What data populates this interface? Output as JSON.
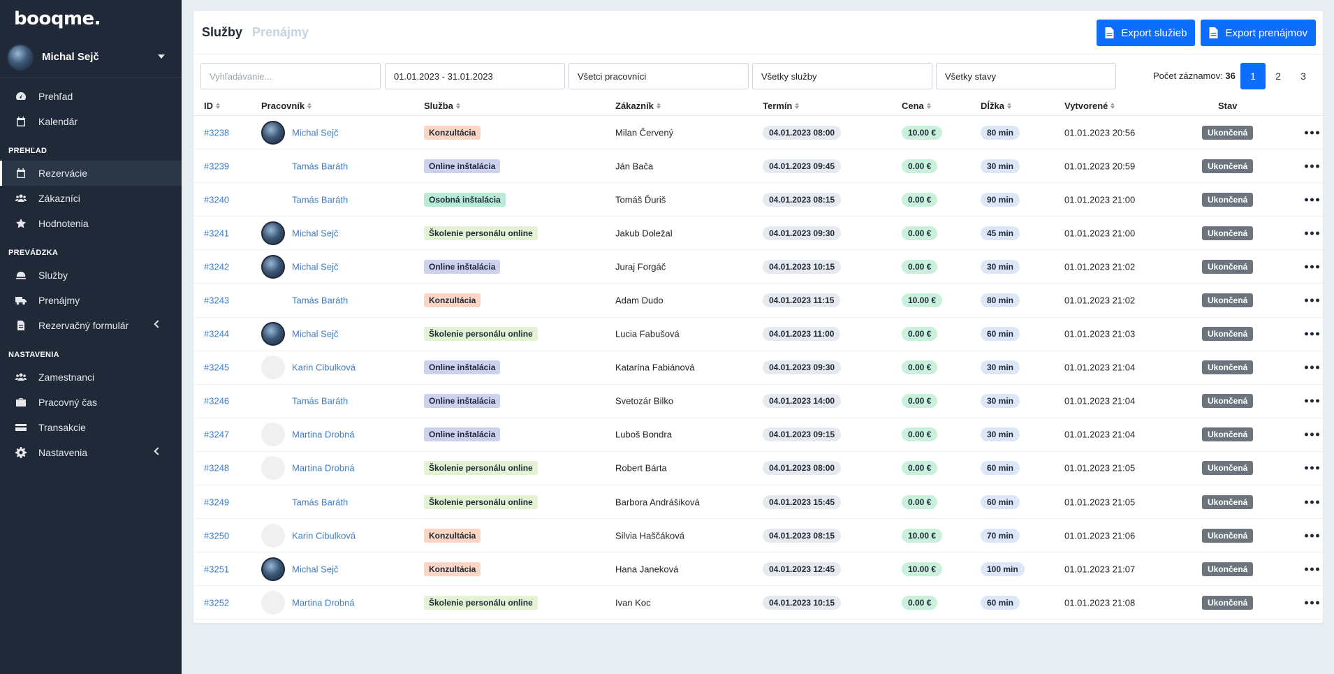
{
  "app": {
    "logo": "booqme."
  },
  "user": {
    "name": "Michal Sejč"
  },
  "sidebar": {
    "top_items": [
      {
        "label": "Prehľad",
        "icon": "gauge-icon"
      },
      {
        "label": "Kalendár",
        "icon": "calendar-icon"
      }
    ],
    "sections": [
      {
        "title": "PREHĽAD",
        "items": [
          {
            "label": "Rezervácie",
            "icon": "calendar-check-icon",
            "active": true
          },
          {
            "label": "Zákazníci",
            "icon": "users-icon"
          },
          {
            "label": "Hodnotenia",
            "icon": "star-icon"
          }
        ]
      },
      {
        "title": "PREVÁDZKA",
        "items": [
          {
            "label": "Služby",
            "icon": "service-icon"
          },
          {
            "label": "Prenájmy",
            "icon": "truck-icon"
          },
          {
            "label": "Rezervačný formulár",
            "icon": "form-icon",
            "chevron": true
          }
        ]
      },
      {
        "title": "NASTAVENIA",
        "items": [
          {
            "label": "Zamestnanci",
            "icon": "users-icon"
          },
          {
            "label": "Pracovný čas",
            "icon": "briefcase-icon"
          },
          {
            "label": "Transakcie",
            "icon": "credit-card-icon"
          },
          {
            "label": "Nastavenia",
            "icon": "gear-icon",
            "chevron": true
          }
        ]
      }
    ]
  },
  "header": {
    "tab_active": "Služby",
    "tab_inactive": "Prenájmy",
    "export_services": "Export služieb",
    "export_rentals": "Export prenájmov"
  },
  "filters": {
    "search_placeholder": "Vyhľadávanie...",
    "date_range": "01.01.2023 - 31.01.2023",
    "workers": "Všetci pracovníci",
    "services": "Všetky služby",
    "states": "Všetky stavy"
  },
  "records": {
    "label": "Počet záznamov:",
    "count": "36"
  },
  "pagination": [
    "1",
    "2",
    "3"
  ],
  "table": {
    "columns": [
      "ID",
      "Pracovník",
      "Služba",
      "Zákazník",
      "Termín",
      "Cena",
      "Dĺžka",
      "Vytvorené",
      "Stav"
    ],
    "rows": [
      {
        "id": "#3238",
        "worker": "Michal Sejč",
        "av": "michal",
        "service": "Konzultácia",
        "svc": "konz",
        "customer": "Milan Červený",
        "term": "04.01.2023 08:00",
        "price": "10.00 €",
        "length": "80 min",
        "created": "01.01.2023 20:56",
        "state": "Ukončená"
      },
      {
        "id": "#3239",
        "worker": "Tamás Baráth",
        "av": "tamas",
        "service": "Online inštalácia",
        "svc": "online",
        "customer": "Ján Bača",
        "term": "04.01.2023 09:45",
        "price": "0.00 €",
        "length": "30 min",
        "created": "01.01.2023 20:59",
        "state": "Ukončená"
      },
      {
        "id": "#3240",
        "worker": "Tamás Baráth",
        "av": "tamas",
        "service": "Osobná inštalácia",
        "svc": "osob",
        "customer": "Tomáš Ďuriš",
        "term": "04.01.2023 08:15",
        "price": "0.00 €",
        "length": "90 min",
        "created": "01.01.2023 21:00",
        "state": "Ukončená"
      },
      {
        "id": "#3241",
        "worker": "Michal Sejč",
        "av": "michal",
        "service": "Školenie personálu online",
        "svc": "skol",
        "customer": "Jakub Doležal",
        "term": "04.01.2023 09:30",
        "price": "0.00 €",
        "length": "45 min",
        "created": "01.01.2023 21:00",
        "state": "Ukončená"
      },
      {
        "id": "#3242",
        "worker": "Michal Sejč",
        "av": "michal",
        "service": "Online inštalácia",
        "svc": "online",
        "customer": "Juraj Forgáč",
        "term": "04.01.2023 10:15",
        "price": "0.00 €",
        "length": "30 min",
        "created": "01.01.2023 21:02",
        "state": "Ukončená"
      },
      {
        "id": "#3243",
        "worker": "Tamás Baráth",
        "av": "tamas",
        "service": "Konzultácia",
        "svc": "konz",
        "customer": "Adam Dudo",
        "term": "04.01.2023 11:15",
        "price": "10.00 €",
        "length": "80 min",
        "created": "01.01.2023 21:02",
        "state": "Ukončená"
      },
      {
        "id": "#3244",
        "worker": "Michal Sejč",
        "av": "michal",
        "service": "Školenie personálu online",
        "svc": "skol",
        "customer": "Lucia Fabušová",
        "term": "04.01.2023 11:00",
        "price": "0.00 €",
        "length": "60 min",
        "created": "01.01.2023 21:03",
        "state": "Ukončená"
      },
      {
        "id": "#3245",
        "worker": "Karin Cibulková",
        "av": "karin",
        "service": "Online inštalácia",
        "svc": "online",
        "customer": "Katarína Fabiánová",
        "term": "04.01.2023 09:30",
        "price": "0.00 €",
        "length": "30 min",
        "created": "01.01.2023 21:04",
        "state": "Ukončená"
      },
      {
        "id": "#3246",
        "worker": "Tamás Baráth",
        "av": "tamas",
        "service": "Online inštalácia",
        "svc": "online",
        "customer": "Svetozár Bilko",
        "term": "04.01.2023 14:00",
        "price": "0.00 €",
        "length": "30 min",
        "created": "01.01.2023 21:04",
        "state": "Ukončená"
      },
      {
        "id": "#3247",
        "worker": "Martina Drobná",
        "av": "martina",
        "service": "Online inštalácia",
        "svc": "online",
        "customer": "Luboš Bondra",
        "term": "04.01.2023 09:15",
        "price": "0.00 €",
        "length": "30 min",
        "created": "01.01.2023 21:04",
        "state": "Ukončená"
      },
      {
        "id": "#3248",
        "worker": "Martina Drobná",
        "av": "martina",
        "service": "Školenie personálu online",
        "svc": "skol",
        "customer": "Robert Bárta",
        "term": "04.01.2023 08:00",
        "price": "0.00 €",
        "length": "60 min",
        "created": "01.01.2023 21:05",
        "state": "Ukončená"
      },
      {
        "id": "#3249",
        "worker": "Tamás Baráth",
        "av": "tamas",
        "service": "Školenie personálu online",
        "svc": "skol",
        "customer": "Barbora Andrášiková",
        "term": "04.01.2023 15:45",
        "price": "0.00 €",
        "length": "60 min",
        "created": "01.01.2023 21:05",
        "state": "Ukončená"
      },
      {
        "id": "#3250",
        "worker": "Karin Cibulková",
        "av": "karin",
        "service": "Konzultácia",
        "svc": "konz",
        "customer": "Silvia Haščáková",
        "term": "04.01.2023 08:15",
        "price": "10.00 €",
        "length": "70 min",
        "created": "01.01.2023 21:06",
        "state": "Ukončená"
      },
      {
        "id": "#3251",
        "worker": "Michal Sejč",
        "av": "michal",
        "service": "Konzultácia",
        "svc": "konz",
        "customer": "Hana Janeková",
        "term": "04.01.2023 12:45",
        "price": "10.00 €",
        "length": "100 min",
        "created": "01.01.2023 21:07",
        "state": "Ukončená"
      },
      {
        "id": "#3252",
        "worker": "Martina Drobná",
        "av": "martina",
        "service": "Školenie personálu online",
        "svc": "skol",
        "customer": "Ivan Koc",
        "term": "04.01.2023 10:15",
        "price": "0.00 €",
        "length": "60 min",
        "created": "01.01.2023 21:08",
        "state": "Ukončená"
      }
    ]
  }
}
